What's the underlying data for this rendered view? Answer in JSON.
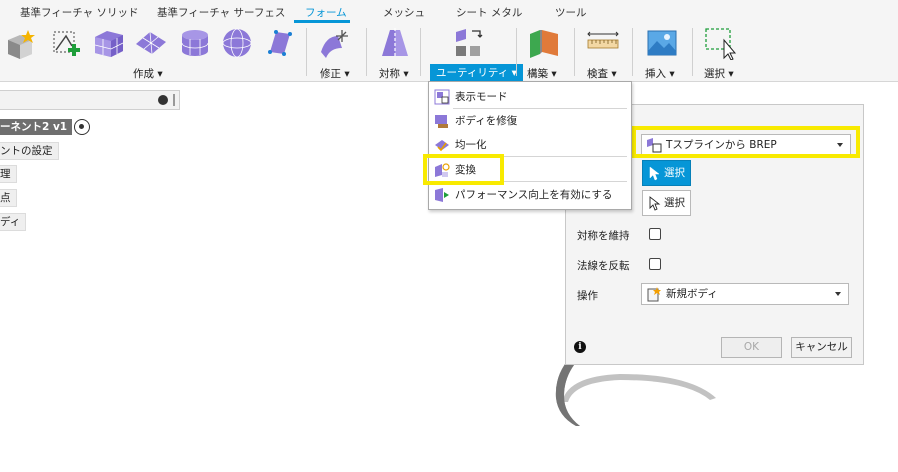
{
  "tabs": [
    {
      "label": "基準フィーチャ ソリッド",
      "active": false
    },
    {
      "label": "基準フィーチャ サーフェス",
      "active": false
    },
    {
      "label": "フォーム",
      "active": true
    },
    {
      "label": "メッシュ",
      "active": false
    },
    {
      "label": "シート メタル",
      "active": false
    },
    {
      "label": "ツール",
      "active": false
    }
  ],
  "ribbon_groups": {
    "create": "作成 ▾",
    "modify": "修正 ▾",
    "symmetry": "対称 ▾",
    "utility": "ユーティリティ ▾",
    "construct": "構築 ▾",
    "inspect": "検査 ▾",
    "insert": "挿入 ▾",
    "select": "選択 ▾"
  },
  "browser": {
    "component": "ーネント2 v1",
    "items": [
      "ントの設定",
      "理",
      "点",
      "ディ"
    ]
  },
  "menu": {
    "items": [
      {
        "label": "表示モード",
        "icon": "display-mode-icon"
      },
      {
        "label": "ボディを修復",
        "icon": "repair-body-icon"
      },
      {
        "label": "均一化",
        "icon": "make-uniform-icon"
      },
      {
        "label": "変換",
        "icon": "convert-icon"
      },
      {
        "label": "パフォーマンス向上を有効にする",
        "icon": "performance-icon"
      }
    ]
  },
  "dialog": {
    "type_value": "Tスプラインから BREP",
    "select_label_1": "選択",
    "select_label_2": "選択",
    "keep_symmetry_label": "対称を維持",
    "flip_normals_label": "法線を反転",
    "operation_label": "操作",
    "operation_value": "新規ボディ",
    "ok_label": "OK",
    "cancel_label": "キャンセル",
    "info_glyph": "i"
  },
  "colors": {
    "accent": "#0696d7",
    "highlight": "#f8ea00",
    "tool_purple": "#8c78d8"
  }
}
